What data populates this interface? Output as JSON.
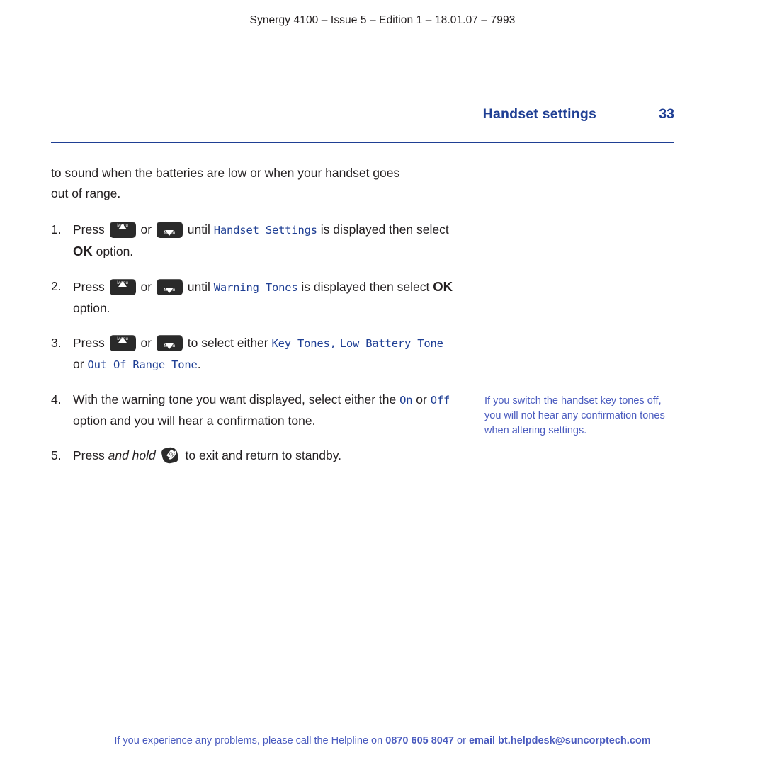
{
  "header": {
    "text": "Synergy 4100 – Issue 5 – Edition 1 – 18.01.07 – 7993"
  },
  "page": {
    "section_title": "Handset settings",
    "number": "33"
  },
  "main": {
    "intro": "to sound when the batteries are low or when your handset goes out of range.",
    "steps": [
      {
        "num": "1.",
        "parts": {
          "press": "Press",
          "or": "or",
          "until": "until",
          "lcd1": "Handset Settings",
          "tail": "is displayed then select",
          "ok": "OK",
          "end": "option."
        }
      },
      {
        "num": "2.",
        "parts": {
          "press": "Press",
          "or": "or",
          "until": "until",
          "lcd1": "Warning Tones",
          "tail": "is displayed then select",
          "ok": "OK",
          "end": "option."
        }
      },
      {
        "num": "3.",
        "parts": {
          "press": "Press",
          "or": "or",
          "select": "to select either",
          "lcd1": "Key Tones",
          "comma": ",",
          "lcd2": "Low Battery Tone",
          "orword": "or",
          "lcd3": "Out Of Range Tone",
          "end": "."
        }
      },
      {
        "num": "4.",
        "parts": {
          "lead": "With the warning tone you want displayed, select either the",
          "lcd1": "On",
          "orword": "or",
          "lcd2": "Off",
          "tail": "option and you will hear a confirmation tone."
        }
      },
      {
        "num": "5.",
        "parts": {
          "press": "Press",
          "italic": "and hold",
          "tail": "to exit and return to standby."
        }
      }
    ]
  },
  "sidebar": {
    "note": "If you switch the handset key tones off, you will not hear any confirmation tones when altering settings."
  },
  "footer": {
    "lead": "If you experience any problems, please call the Helpline on",
    "phone": "0870 605 8047",
    "mid": "or",
    "email": "email bt.helpdesk@suncorptech.com"
  },
  "keys": {
    "up_label": "Menu",
    "down_label": "Menu"
  }
}
